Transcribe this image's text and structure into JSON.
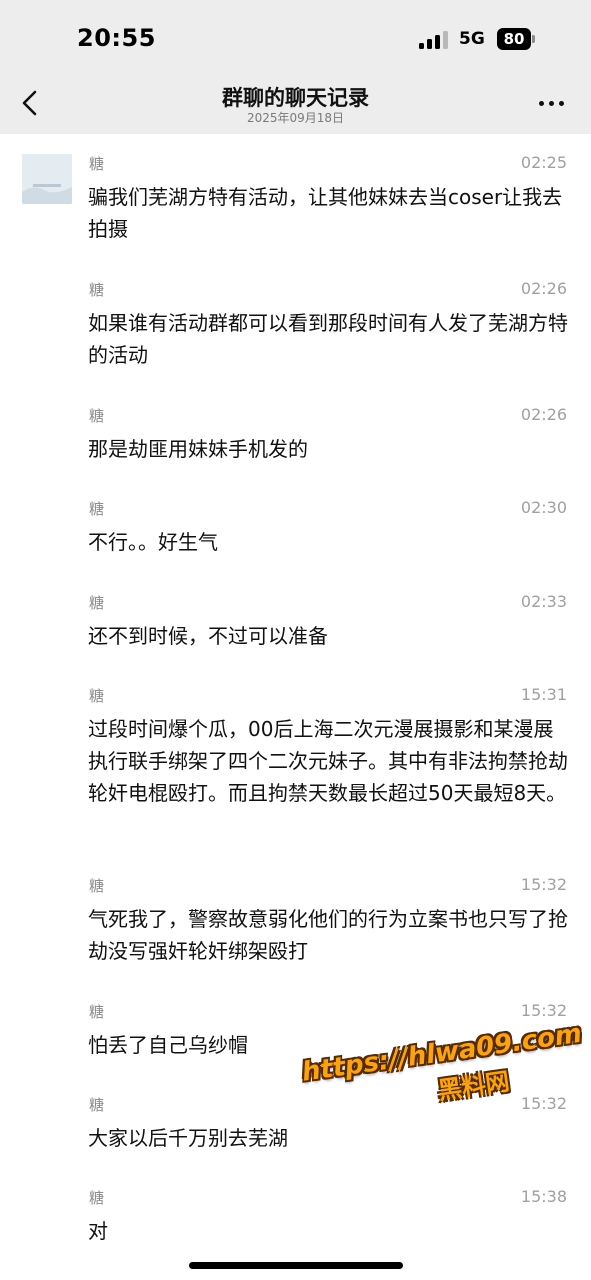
{
  "status_bar": {
    "time": "20:55",
    "network": "5G",
    "battery": "80"
  },
  "header": {
    "title": "群聊的聊天记录",
    "date": "2025年09月18日"
  },
  "messages": [
    {
      "sender": "糖",
      "time": "02:25",
      "text": "骗我们芜湖方特有活动，让其他妹妹去当coser让我去拍摄"
    },
    {
      "sender": "糖",
      "time": "02:26",
      "text": "如果谁有活动群都可以看到那段时间有人发了芜湖方特的活动"
    },
    {
      "sender": "糖",
      "time": "02:26",
      "text": "那是劫匪用妹妹手机发的"
    },
    {
      "sender": "糖",
      "time": "02:30",
      "text": "不行。。好生气"
    },
    {
      "sender": "糖",
      "time": "02:33",
      "text": "还不到时候，不过可以准备"
    },
    {
      "sender": "糖",
      "time": "15:31",
      "text": "过段时间爆个瓜，00后上海二次元漫展摄影和某漫展执行联手绑架了四个二次元妹子。其中有非法拘禁抢劫轮奸电棍殴打。而且拘禁天数最长超过50天最短8天。"
    },
    {
      "sender": "糖",
      "time": "15:32",
      "text": "气死我了，警察故意弱化他们的行为立案书也只写了抢劫没写强奸轮奸绑架殴打"
    },
    {
      "sender": "糖",
      "time": "15:32",
      "text": "怕丢了自己乌纱帽"
    },
    {
      "sender": "糖",
      "time": "15:32",
      "text": "大家以后千万别去芜湖"
    },
    {
      "sender": "糖",
      "time": "15:38",
      "text": "对"
    }
  ],
  "watermark": {
    "url": "https://hlwa09.com",
    "name": "黑料网"
  }
}
